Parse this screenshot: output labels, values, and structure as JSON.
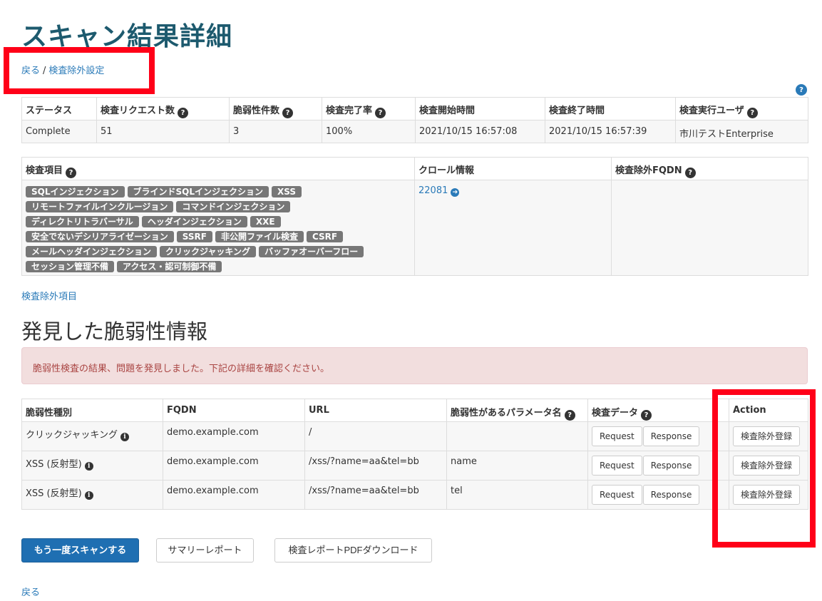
{
  "page_title": "スキャン結果詳細",
  "breadcrumb": {
    "back": "戻る",
    "separator": "/",
    "exclusion_settings": "検査除外設定"
  },
  "help_glyph": "?",
  "info_glyph": "i",
  "status_table": {
    "headers": [
      "ステータス",
      "検査リクエスト数",
      "脆弱性件数",
      "検査完了率",
      "検査開始時間",
      "検査終了時間",
      "検査実行ユーザ"
    ],
    "values": [
      "Complete",
      "51",
      "3",
      "100%",
      "2021/10/15 16:57:08",
      "2021/10/15 16:57:39",
      "市川テストEnterprise"
    ]
  },
  "items_table": {
    "headers": [
      "検査項目",
      "クロール情報",
      "検査除外FQDN"
    ],
    "tags": [
      "SQLインジェクション",
      "ブラインドSQLインジェクション",
      "XSS",
      "リモートファイルインクルージョン",
      "コマンドインジェクション",
      "ディレクトリトラバーサル",
      "ヘッダインジェクション",
      "XXE",
      "安全でないデシリアライゼーション",
      "SSRF",
      "非公開ファイル検査",
      "CSRF",
      "メールヘッダインジェクション",
      "クリックジャッキング",
      "バッファオーバーフロー",
      "セッション管理不備",
      "アクセス・認可制御不備"
    ],
    "crawl_id": "22081",
    "crawl_arrow": "➔"
  },
  "excluded_items_link": "検査除外項目",
  "section_title": "発見した脆弱性情報",
  "alert_text": "脆弱性検査の結果、問題を発見しました。下記の詳細を確認ください。",
  "vuln_table": {
    "headers": [
      "脆弱性種別",
      "FQDN",
      "URL",
      "脆弱性があるパラメータ名",
      "検査データ",
      "Action"
    ],
    "rows": [
      {
        "type": "クリックジャッキング",
        "fqdn": "demo.example.com",
        "url": "/",
        "param": ""
      },
      {
        "type": "XSS (反射型)",
        "fqdn": "demo.example.com",
        "url": "/xss/?name=aa&tel=bb",
        "param": "name"
      },
      {
        "type": "XSS (反射型)",
        "fqdn": "demo.example.com",
        "url": "/xss/?name=aa&tel=bb",
        "param": "tel"
      }
    ],
    "request_label": "Request",
    "response_label": "Response",
    "exclude_label": "検査除外登録"
  },
  "buttons": {
    "rescan": "もう一度スキャンする",
    "summary": "サマリーレポート",
    "pdf": "検査レポートPDFダウンロード"
  },
  "back_link": "戻る",
  "colors": {
    "title": "#1d5a6e",
    "link": "#2a7ab8",
    "primary": "#1f6fb2",
    "alert_bg": "#f2dede",
    "alert_text": "#a94442",
    "tag": "#777777",
    "highlight": "#ff0018"
  }
}
